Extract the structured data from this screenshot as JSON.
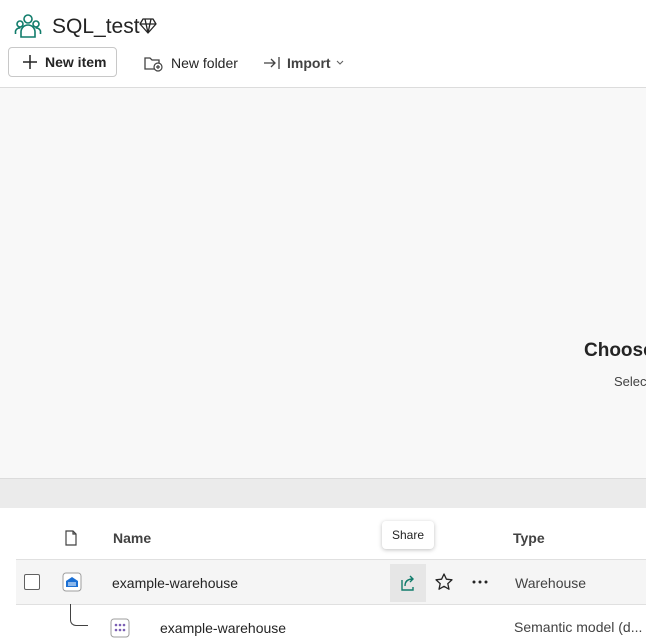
{
  "workspace": {
    "title": "SQL_test",
    "icon": "people-group-icon",
    "badge_icon": "diamond-icon"
  },
  "toolbar": {
    "new_item": "New item",
    "new_folder": "New folder",
    "import": "Import"
  },
  "empty_state": {
    "title": "Choose",
    "subtitle": "Selec"
  },
  "table": {
    "headers": {
      "name": "Name",
      "type": "Type"
    },
    "tooltip": "Share",
    "rows": [
      {
        "name": "example-warehouse",
        "type": "Warehouse",
        "icon": "warehouse-icon"
      },
      {
        "name": "example-warehouse",
        "type": "Semantic model (d...",
        "icon": "semantic-model-icon"
      }
    ]
  },
  "colors": {
    "accent": "#107c6b",
    "warehouse": "#1a6fd4",
    "semantic": "#7b5fb4"
  }
}
